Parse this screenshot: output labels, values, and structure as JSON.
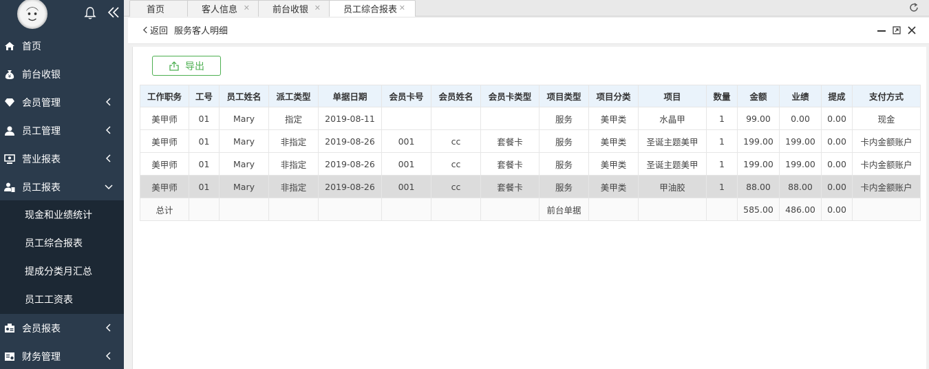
{
  "sidebar": {
    "items": [
      {
        "label": "首页",
        "icon": "home-icon"
      },
      {
        "label": "前台收银",
        "icon": "money-bag-icon"
      },
      {
        "label": "会员管理",
        "icon": "diamond-icon"
      },
      {
        "label": "员工管理",
        "icon": "user-icon"
      },
      {
        "label": "营业报表",
        "icon": "monitor-icon"
      },
      {
        "label": "员工报表",
        "icon": "staff-report-icon"
      },
      {
        "label": "会员报表",
        "icon": "member-card-icon"
      },
      {
        "label": "财务管理",
        "icon": "finance-icon"
      }
    ],
    "subitems": [
      {
        "label": "现金和业绩统计"
      },
      {
        "label": "员工综合报表"
      },
      {
        "label": "提成分类月汇总"
      },
      {
        "label": "员工工资表"
      }
    ]
  },
  "tabs": [
    {
      "label": "首页"
    },
    {
      "label": "客人信息"
    },
    {
      "label": "前台收银"
    },
    {
      "label": "员工综合报表"
    }
  ],
  "breadcrumb": {
    "back_label": "返回",
    "title": "服务客人明细"
  },
  "toolbar": {
    "export_label": "导出"
  },
  "table": {
    "headers": [
      "工作职务",
      "工号",
      "员工姓名",
      "派工类型",
      "单据日期",
      "会员卡号",
      "会员姓名",
      "会员卡类型",
      "项目类型",
      "项目分类",
      "项目",
      "数量",
      "金额",
      "业绩",
      "提成",
      "支付方式"
    ],
    "rows": [
      [
        "美甲师",
        "01",
        "Mary",
        "指定",
        "2019-08-11",
        "",
        "",
        "",
        "服务",
        "美甲类",
        "水晶甲",
        "1",
        "99.00",
        "0.00",
        "0.00",
        "现金"
      ],
      [
        "美甲师",
        "01",
        "Mary",
        "非指定",
        "2019-08-26",
        "001",
        "cc",
        "套餐卡",
        "服务",
        "美甲类",
        "圣诞主题美甲",
        "1",
        "199.00",
        "199.00",
        "0.00",
        "卡内金额账户"
      ],
      [
        "美甲师",
        "01",
        "Mary",
        "非指定",
        "2019-08-26",
        "001",
        "cc",
        "套餐卡",
        "服务",
        "美甲类",
        "圣诞主题美甲",
        "1",
        "199.00",
        "199.00",
        "0.00",
        "卡内金额账户"
      ],
      [
        "美甲师",
        "01",
        "Mary",
        "非指定",
        "2019-08-26",
        "001",
        "cc",
        "套餐卡",
        "服务",
        "美甲类",
        "甲油胶",
        "1",
        "88.00",
        "88.00",
        "0.00",
        "卡内金额账户"
      ]
    ],
    "total": [
      "总计",
      "",
      "",
      "",
      "",
      "",
      "",
      "",
      "前台单据",
      "",
      "",
      "",
      "585.00",
      "486.00",
      "0.00",
      ""
    ]
  },
  "colors": {
    "sidebar_bg": "#2b3b4c",
    "submenu_bg": "#1c2834",
    "accent_green": "#4caf50",
    "header_bg": "#eaf3fb"
  }
}
